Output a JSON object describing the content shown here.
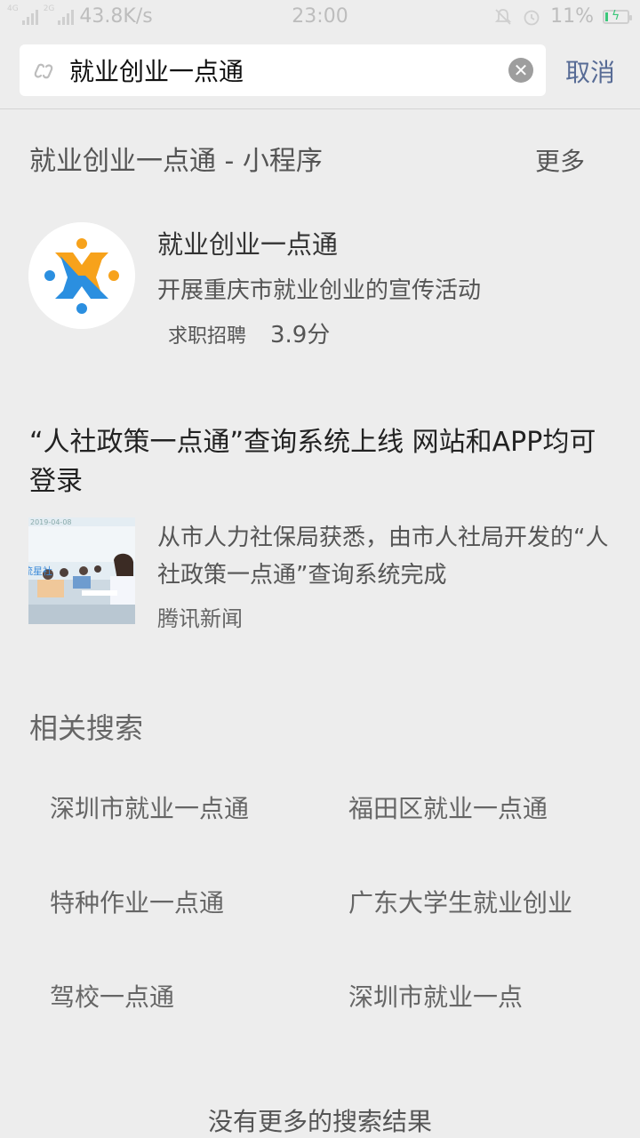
{
  "status_bar": {
    "net_label_1": "4G",
    "net_label_2": "2G",
    "speed": "43.8K/s",
    "time": "23:00",
    "battery": "11%",
    "battery_level": 0.11,
    "icons": [
      "signal-icon",
      "mute-icon",
      "alarm-icon",
      "battery-icon"
    ]
  },
  "search": {
    "query": "就业创业一点通",
    "cancel_label": "取消",
    "icons": [
      "link-icon",
      "clear-icon"
    ]
  },
  "mini_program": {
    "section_title": "就业创业一点通 - 小程序",
    "more_label": "更多",
    "app": {
      "name": "就业创业一点通",
      "description": "开展重庆市就业创业的宣传活动",
      "category": "求职招聘",
      "rating": "3.9分",
      "logo_colors": [
        "#f7a21b",
        "#2b8fe0"
      ]
    }
  },
  "news": {
    "title": "“人社政策一点通”查询系统上线 网站和APP均可登录",
    "summary": "从市人力社保局获悉，由市人社局开发的“人社政策一点通”查询系统完成",
    "source": "腾讯新闻",
    "thumb_date": "2019-04-08",
    "thumb_tag": "流星社"
  },
  "related": {
    "title": "相关搜索",
    "items": [
      "深圳市就业一点通",
      "福田区就业一点通",
      "特种作业一点通",
      "广东大学生就业创业",
      "驾校一点通",
      "深圳市就业一点"
    ]
  },
  "footer": {
    "no_more": "没有更多的搜索结果"
  },
  "colors": {
    "background": "#ededed",
    "link": "#576b95",
    "battery_green": "#3bc77a"
  }
}
